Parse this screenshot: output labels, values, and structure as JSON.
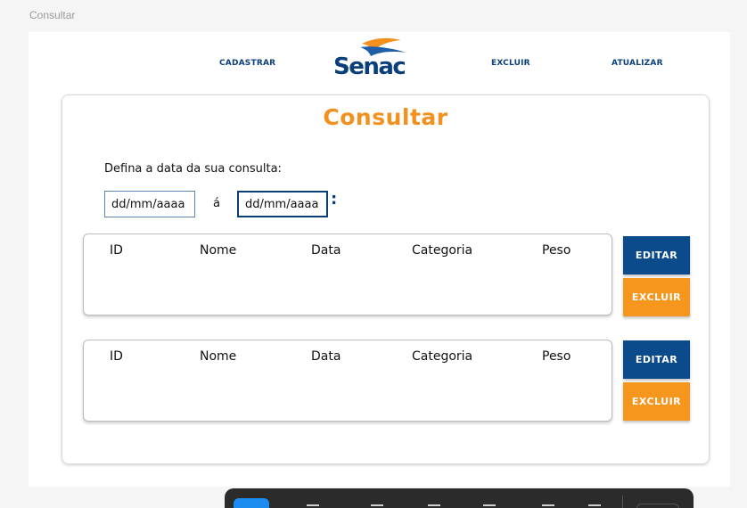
{
  "frame_label": "Consultar",
  "nav": {
    "cadastrar": "CADASTRAR",
    "excluir": "EXCLUIR",
    "atualizar": "ATUALIZAR",
    "logo_text": "Senac"
  },
  "card": {
    "title": "Consultar",
    "date_prompt": "Defina a data da sua consulta:",
    "date_from": "dd/mm/aaaa",
    "date_separator": "á",
    "date_to": "dd/mm/aaaa",
    "date_suffix": ":"
  },
  "results": [
    {
      "columns": [
        "ID",
        "Nome",
        "Data",
        "Categoria",
        "Peso"
      ],
      "edit_label": "EDITAR",
      "delete_label": "EXCLUIR"
    },
    {
      "columns": [
        "ID",
        "Nome",
        "Data",
        "Categoria",
        "Peso"
      ],
      "edit_label": "EDITAR",
      "delete_label": "EXCLUIR"
    }
  ],
  "colors": {
    "brand_blue": "#0b3f7a",
    "brand_orange": "#f3901e",
    "edit_button": "#0b4a8b",
    "delete_button": "#f6961c"
  },
  "toolbar": {
    "icons": [
      "select-icon",
      "frame-icon",
      "rectangle-icon",
      "pen-icon",
      "text-icon",
      "comment-icon",
      "dev-mode-icon"
    ]
  }
}
